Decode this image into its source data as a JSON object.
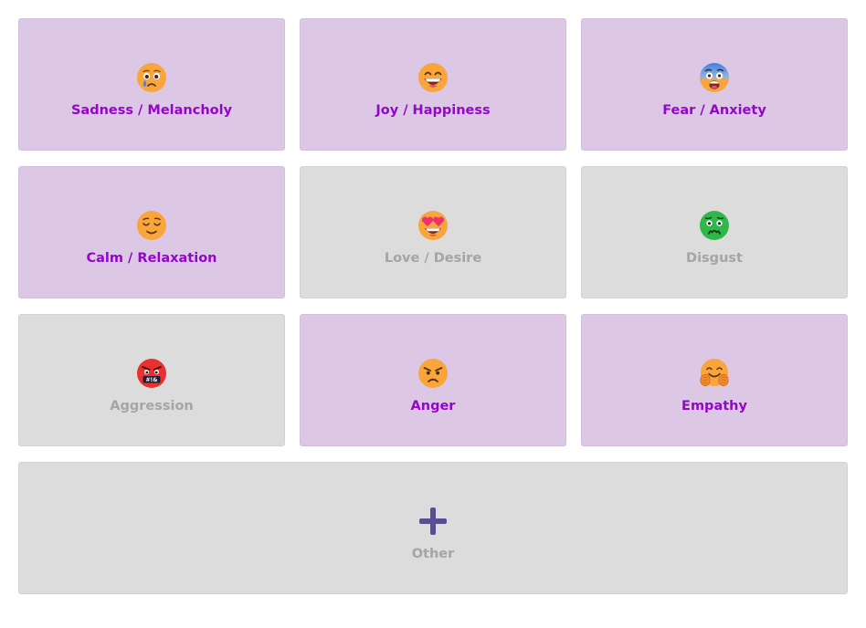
{
  "categories": [
    {
      "label": "Sadness / Melancholy",
      "icon": "crying-face-icon",
      "selected": true
    },
    {
      "label": "Joy / Happiness",
      "icon": "grinning-face-icon",
      "selected": true
    },
    {
      "label": "Fear / Anxiety",
      "icon": "fearful-face-icon",
      "selected": true
    },
    {
      "label": "Calm / Relaxation",
      "icon": "relieved-face-icon",
      "selected": true
    },
    {
      "label": "Love / Desire",
      "icon": "heart-eyes-face-icon",
      "selected": false
    },
    {
      "label": "Disgust",
      "icon": "nauseated-face-icon",
      "selected": false
    },
    {
      "label": "Aggression",
      "icon": "cursing-face-icon",
      "selected": false
    },
    {
      "label": "Anger",
      "icon": "angry-face-icon",
      "selected": true
    },
    {
      "label": "Empathy",
      "icon": "hugging-face-icon",
      "selected": true
    }
  ],
  "other": {
    "label": "Other",
    "icon": "plus-icon",
    "selected": false
  },
  "colors": {
    "selected_bg": "#dcc8e5",
    "selected_text": "#9406c9",
    "unselected_bg": "#dcdcdc",
    "unselected_text": "#a5a5a5",
    "plus_icon": "#5b4d94"
  }
}
